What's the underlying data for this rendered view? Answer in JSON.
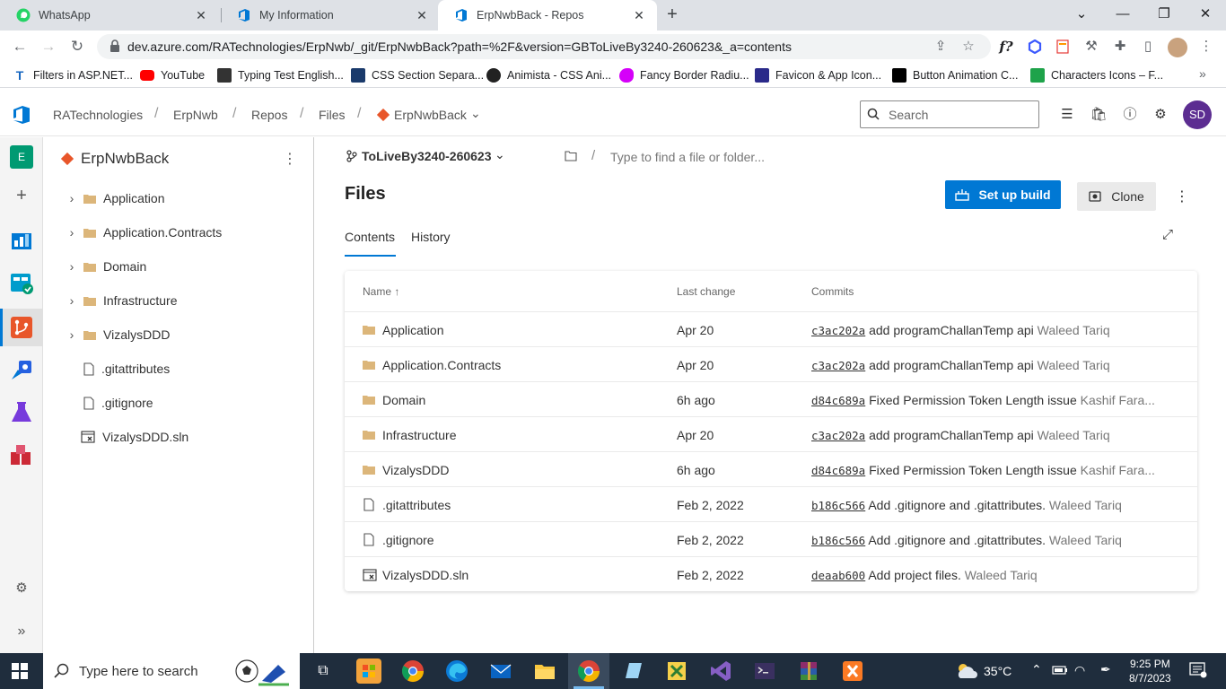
{
  "browser": {
    "tabs": [
      {
        "title": "WhatsApp",
        "icon": "whatsapp-icon"
      },
      {
        "title": "My Information",
        "icon": "azure-devops-icon"
      },
      {
        "title": "ErpNwbBack - Repos",
        "icon": "azure-devops-icon",
        "active": true
      }
    ],
    "url": "dev.azure.com/RATechnologies/ErpNwb/_git/ErpNwbBack?path=%2F&version=GBToLiveBy3240-260623&_a=contents",
    "bookmarks": [
      {
        "label": "Filters in ASP.NET...",
        "icon": "bookmark-icon",
        "color": "#1565c0"
      },
      {
        "label": "YouTube",
        "icon": "youtube-icon",
        "color": "#ff0000"
      },
      {
        "label": "Typing Test English...",
        "icon": "typing-icon",
        "color": "#333333"
      },
      {
        "label": "CSS Section Separa...",
        "icon": "css-icon",
        "color": "#1a3a6b"
      },
      {
        "label": "Animista - CSS Ani...",
        "icon": "animista-icon",
        "color": "#222222"
      },
      {
        "label": "Fancy Border Radiu...",
        "icon": "blob-icon",
        "color": "#d500f9"
      },
      {
        "label": "Favicon & App Icon...",
        "icon": "favicon-icon",
        "color": "#2a2a8a"
      },
      {
        "label": "Button Animation C...",
        "icon": "dev-icon",
        "color": "#000000"
      },
      {
        "label": "Characters Icons – F...",
        "icon": "characters-icon",
        "color": "#1ea34a"
      }
    ]
  },
  "header": {
    "org": "RATechnologies",
    "project": "ErpNwb",
    "section": "Repos",
    "subsection": "Files",
    "repo": "ErpNwbBack",
    "search_placeholder": "Search",
    "avatar": "SD",
    "accent": "#0078d4"
  },
  "rail": {
    "project_initial": "E"
  },
  "tree": {
    "title": "ErpNwbBack",
    "items": [
      {
        "label": "Application",
        "type": "folder"
      },
      {
        "label": "Application.Contracts",
        "type": "folder"
      },
      {
        "label": "Domain",
        "type": "folder"
      },
      {
        "label": "Infrastructure",
        "type": "folder"
      },
      {
        "label": "VizalysDDD",
        "type": "folder"
      },
      {
        "label": ".gitattributes",
        "type": "file"
      },
      {
        "label": ".gitignore",
        "type": "file"
      },
      {
        "label": "VizalysDDD.sln",
        "type": "sln"
      }
    ]
  },
  "main": {
    "branch": "ToLiveBy3240-260623",
    "path_placeholder": "Type to find a file or folder...",
    "title": "Files",
    "setup_build": "Set up build",
    "clone": "Clone",
    "tabs": {
      "contents": "Contents",
      "history": "History"
    },
    "columns": {
      "name": "Name ↑",
      "last_change": "Last change",
      "commits": "Commits"
    },
    "files": [
      {
        "name": "Application",
        "type": "folder",
        "last_change": "Apr 20",
        "hash": "c3ac202a",
        "message": "add programChallanTemp api",
        "author": "Waleed Tariq"
      },
      {
        "name": "Application.Contracts",
        "type": "folder",
        "last_change": "Apr 20",
        "hash": "c3ac202a",
        "message": "add programChallanTemp api",
        "author": "Waleed Tariq"
      },
      {
        "name": "Domain",
        "type": "folder",
        "last_change": "6h ago",
        "hash": "d84c689a",
        "message": "Fixed Permission Token Length issue",
        "author": "Kashif Fara..."
      },
      {
        "name": "Infrastructure",
        "type": "folder",
        "last_change": "Apr 20",
        "hash": "c3ac202a",
        "message": "add programChallanTemp api",
        "author": "Waleed Tariq"
      },
      {
        "name": "VizalysDDD",
        "type": "folder",
        "last_change": "6h ago",
        "hash": "d84c689a",
        "message": "Fixed Permission Token Length issue",
        "author": "Kashif Fara..."
      },
      {
        "name": ".gitattributes",
        "type": "file",
        "last_change": "Feb 2, 2022",
        "hash": "b186c566",
        "message": "Add .gitignore and .gitattributes.",
        "author": "Waleed Tariq"
      },
      {
        "name": ".gitignore",
        "type": "file",
        "last_change": "Feb 2, 2022",
        "hash": "b186c566",
        "message": "Add .gitignore and .gitattributes.",
        "author": "Waleed Tariq"
      },
      {
        "name": "VizalysDDD.sln",
        "type": "sln",
        "last_change": "Feb 2, 2022",
        "hash": "deaab600",
        "message": "Add project files.",
        "author": "Waleed Tariq"
      }
    ]
  },
  "taskbar": {
    "search_placeholder": "Type here to search",
    "temperature": "35°C",
    "time": "9:25 PM",
    "date": "8/7/2023"
  }
}
